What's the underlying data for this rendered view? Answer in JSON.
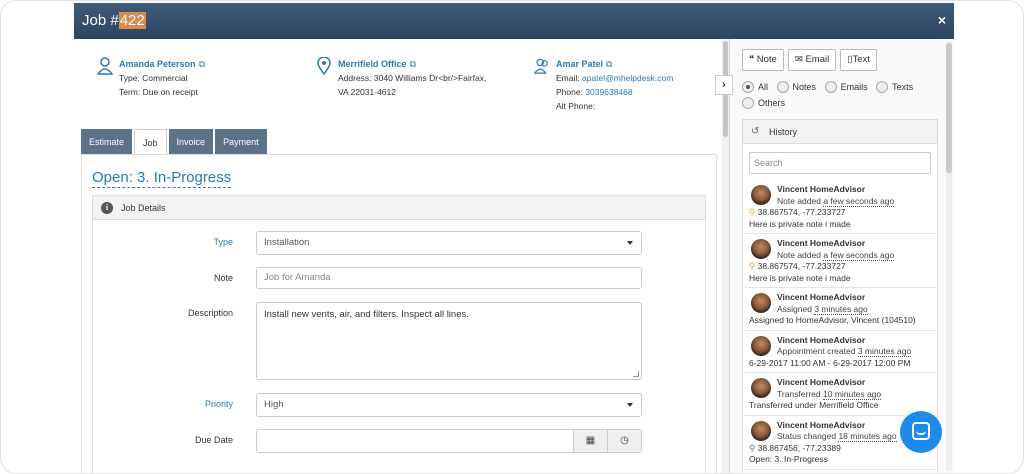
{
  "modal": {
    "title_prefix": "Job #",
    "title_number": "422",
    "close_label": "×"
  },
  "contacts": [
    {
      "name": "Amanda Peterson",
      "line1": "Type: Commercial",
      "line2": "Term: Due on receipt"
    },
    {
      "name": "Merrifield Office",
      "line1": "Address: 3040 Williams Dr<br/>Fairfax,",
      "line2": "VA 22031-4612"
    },
    {
      "name": "Amar Patel",
      "email_label": "Email:",
      "email": "apatel@mhelpdesk.com",
      "phone_label": "Phone:",
      "phone": "3039638468",
      "alt_phone_label": "Alt Phone:"
    }
  ],
  "tabs": [
    {
      "label": "Estimate",
      "active": false
    },
    {
      "label": "Job",
      "active": true
    },
    {
      "label": "Invoice",
      "active": false
    },
    {
      "label": "Payment",
      "active": false
    }
  ],
  "job": {
    "status": "Open: 3. In-Progress",
    "details_title": "Job Details",
    "fields": {
      "type_label": "Type",
      "type_value": "Installation",
      "note_label": "Note",
      "note_placeholder": "Job for Amanda",
      "description_label": "Description",
      "description_value": "Install new vents, air, and filters. Inspect all lines.",
      "priority_label": "Priority",
      "priority_value": "High",
      "due_date_label": "Due Date"
    }
  },
  "side": {
    "buttons": [
      {
        "icon": "quote-icon",
        "glyph": "❝",
        "label": "Note"
      },
      {
        "icon": "envelope-icon",
        "glyph": "✉",
        "label": "Email"
      },
      {
        "icon": "phone-icon",
        "glyph": "▯",
        "label": "Text"
      }
    ],
    "filters": [
      {
        "label": "All",
        "selected": true
      },
      {
        "label": "Notes",
        "selected": false
      },
      {
        "label": "Emails",
        "selected": false
      },
      {
        "label": "Texts",
        "selected": false
      },
      {
        "label": "Others",
        "selected": false
      }
    ],
    "history_title": "History",
    "search_placeholder": "Search",
    "history": [
      {
        "name": "Vincent HomeAdvisor",
        "action": "Note added",
        "ago": "a few seconds ago",
        "location": "38.867574, -77.233727",
        "note": "Here is private note i made"
      },
      {
        "name": "Vincent HomeAdvisor",
        "action": "Note added",
        "ago": "a few seconds ago",
        "location": "38.867574, -77.233727",
        "note": "Here is private note i made"
      },
      {
        "name": "Vincent HomeAdvisor",
        "action": "Assigned",
        "ago": "3 minutes ago",
        "location": "",
        "note": "Assigned to HomeAdvisor, Vincent (104510)"
      },
      {
        "name": "Vincent HomeAdvisor",
        "action": "Appointment created",
        "ago": "3 minutes ago",
        "location": "",
        "note": "6-29-2017 11:00 AM - 6-29-2017 12:00 PM"
      },
      {
        "name": "Vincent HomeAdvisor",
        "action": "Transferred",
        "ago": "10 minutes ago",
        "location": "",
        "note": "Transferred under Merrifield Office"
      },
      {
        "name": "Vincent HomeAdvisor",
        "action": "Status changed",
        "ago": "18 minutes ago",
        "location": "38.867456, -77.23389",
        "note": "Open: 3. In-Progress"
      }
    ]
  },
  "colors": {
    "titlebar": "#2d4562",
    "link": "#2a7ab8",
    "tab_inactive": "#5b7289",
    "chat": "#1f8ceb"
  }
}
